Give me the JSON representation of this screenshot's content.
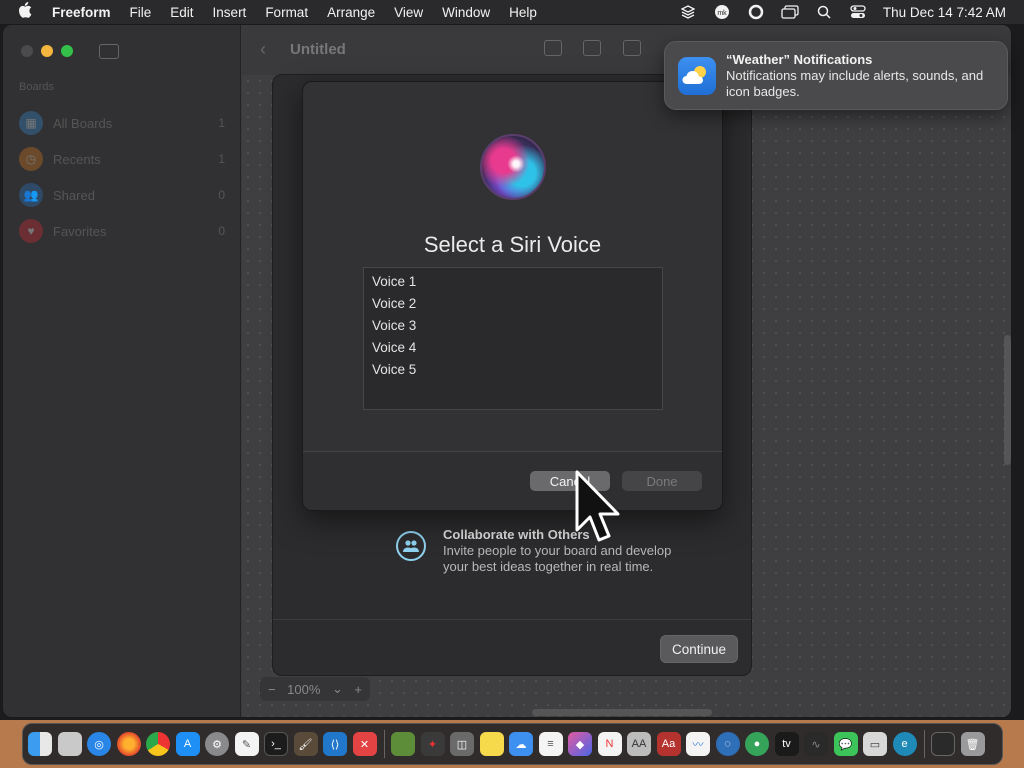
{
  "menubar": {
    "apple": "",
    "app_name": "Freeform",
    "items": [
      "File",
      "Edit",
      "Insert",
      "Format",
      "Arrange",
      "View",
      "Window",
      "Help"
    ],
    "clock": "Thu Dec 14  7:42 AM"
  },
  "sidebar": {
    "heading": "Boards",
    "items": [
      {
        "label": "All Boards",
        "count": "1"
      },
      {
        "label": "Recents",
        "count": "1"
      },
      {
        "label": "Shared",
        "count": "0"
      },
      {
        "label": "Favorites",
        "count": "0"
      }
    ]
  },
  "toolbar": {
    "title": "Untitled",
    "back_icon": "‹"
  },
  "zoom": {
    "minus": "−",
    "value": "100%",
    "chevron": "⌄",
    "plus": "+"
  },
  "welcome": {
    "collab_title": "Collaborate with Others",
    "collab_desc": "Invite people to your board and develop your best ideas together in real time.",
    "continue": "Continue"
  },
  "siri_dialog": {
    "title": "Select a Siri Voice",
    "voices": [
      "Voice 1",
      "Voice 2",
      "Voice 3",
      "Voice 4",
      "Voice 5"
    ],
    "cancel": "Cancel",
    "done": "Done"
  },
  "notification": {
    "title": "“Weather” Notifications",
    "body": "Notifications may include alerts, sounds, and icon badges."
  },
  "colors": {
    "accent_blue": "#2f7fe8",
    "traffic_min": "#f4b63f",
    "traffic_max": "#34c14a"
  },
  "dock": {
    "icons": [
      "finder-icon",
      "launchpad-icon",
      "safari-icon",
      "firefox-icon",
      "chrome-icon",
      "app-store-icon",
      "system-settings-icon",
      "textedit-icon",
      "terminal-icon",
      "brush-icon",
      "vscode-icon",
      "close-app-icon",
      "minecraft-icon",
      "audio-icon",
      "screenshot-icon",
      "notes-icon",
      "weather-icon",
      "reminders-icon",
      "shortcuts-icon",
      "news-icon",
      "font-book-icon",
      "dictionary-icon",
      "freeform-icon",
      "disk-icon",
      "browser-icon",
      "appletv-icon",
      "stocks-icon",
      "messages-icon",
      "preview-icon",
      "edge-icon",
      "window-icon",
      "trash-icon"
    ]
  }
}
